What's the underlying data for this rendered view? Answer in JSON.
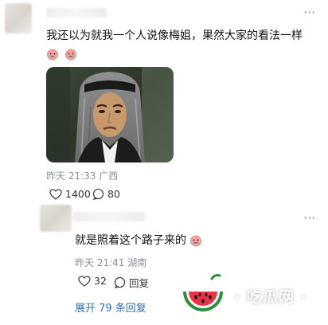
{
  "comment1": {
    "text": "我还以为就我一个人说像梅姐，果然大家的看法一样",
    "meta": "昨天 21:33  广西",
    "like_count": "1400",
    "reply_count": "80"
  },
  "reply1": {
    "text": "就是照着这个路子来的",
    "meta": "昨天 21:41  湖南",
    "like_count": "32",
    "reply_label": "回复"
  },
  "expand_replies": "展开 79 条回复",
  "watermark": {
    "text": "· 吃瓜网 ·"
  },
  "icons": {
    "more": "more-dots-icon",
    "like": "heart-icon",
    "reply": "comment-bubble-icon",
    "emoji": "crying-face-emoji",
    "watermark_logo": "watermelon-icon"
  },
  "colors": {
    "link": "#2d6fb5",
    "meta": "#8a8f98",
    "watermelon_red": "#e8334a",
    "watermelon_green": "#2f8f3a"
  }
}
